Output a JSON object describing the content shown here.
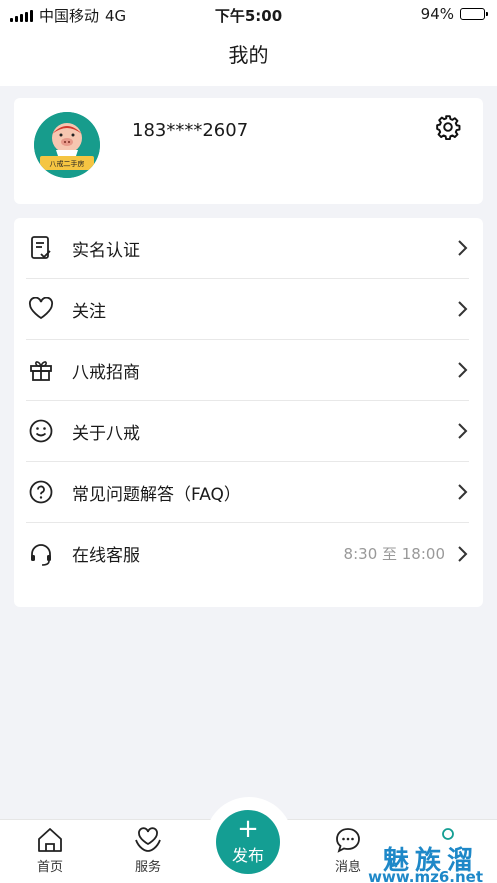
{
  "status_bar": {
    "carrier": "中国移动",
    "network": "4G",
    "time": "下午5:00",
    "battery": "94%",
    "battery_level": 0.94
  },
  "header": {
    "title": "我的"
  },
  "profile": {
    "phone": "183****2607",
    "avatar_caption": "八戒二手房"
  },
  "menu": {
    "items": [
      {
        "label": "实名认证",
        "icon": "id-verify-icon"
      },
      {
        "label": "关注",
        "icon": "heart-icon"
      },
      {
        "label": "八戒招商",
        "icon": "gift-icon"
      },
      {
        "label": "关于八戒",
        "icon": "smile-icon"
      },
      {
        "label": "常见问题解答（FAQ）",
        "icon": "question-icon"
      },
      {
        "label": "在线客服",
        "icon": "headset-icon",
        "extra": "8:30 至 18:00"
      }
    ]
  },
  "tabbar": {
    "home": "首页",
    "service": "服务",
    "publish": "发布",
    "messages": "消息",
    "accent_color": "#149e93"
  },
  "watermark": {
    "title": "魅族溜",
    "url": "www.mz6.net"
  }
}
